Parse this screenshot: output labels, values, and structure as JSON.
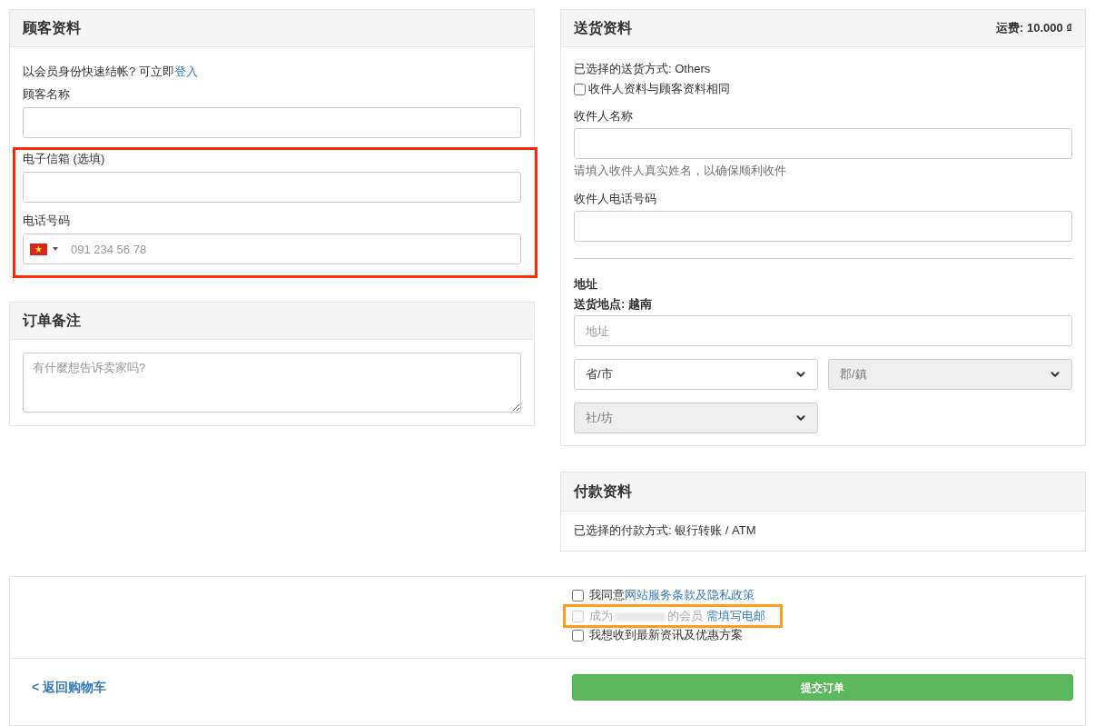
{
  "customer": {
    "title": "顾客资料",
    "login_prompt": {
      "text": "以会员身份快速结帐? 可立即",
      "link": "登入"
    },
    "fields": [
      {
        "kind": "text",
        "label": "顾客名称",
        "highlighted": false
      },
      {
        "kind": "text",
        "label": "电子信箱 (选填)",
        "highlighted": true
      },
      {
        "kind": "phone",
        "label": "电话号码",
        "placeholder": "091 234 56 78",
        "highlighted": true
      }
    ]
  },
  "order_notes": {
    "title": "订单备注",
    "placeholder": "有什麼想告诉卖家吗?"
  },
  "shipping": {
    "title": "送货资料",
    "fee": "运费: 10.000 ₫",
    "method": "已选择的送货方式: Others",
    "same_as_customer": {
      "label": "收件人资料与顾客资料相同",
      "checked": false
    },
    "fields": [
      {
        "label": "收件人名称",
        "help": "请填入收件人真实姓名，以确保顺利收件"
      },
      {
        "label": "收件人电话号码"
      }
    ],
    "address": {
      "label": "地址",
      "location": "送货地点: 越南",
      "placeholder": "地址",
      "selects": [
        {
          "placeholder": "省/市",
          "disabled": false
        },
        {
          "placeholder": "郡/鎮",
          "disabled": true
        },
        {
          "placeholder": "社/坊",
          "disabled": true
        }
      ]
    }
  },
  "payment": {
    "title": "付款资料",
    "method": "已选择的付款方式: 银行转账 / ATM"
  },
  "footer": {
    "consents": [
      {
        "before": "我同意",
        "link": "网站服务条款及隐私政策",
        "checked": false,
        "disabled": false,
        "highlighted": false
      },
      {
        "before": "成为",
        "redacted": true,
        "after": "的会员",
        "link": "需填写电邮",
        "checked": false,
        "disabled": true,
        "highlighted": true
      },
      {
        "before": "我想收到最新资讯及优惠方案",
        "checked": false,
        "disabled": false,
        "highlighted": false
      }
    ],
    "back_link": "< 返回购物车",
    "submit": "提交订单"
  }
}
